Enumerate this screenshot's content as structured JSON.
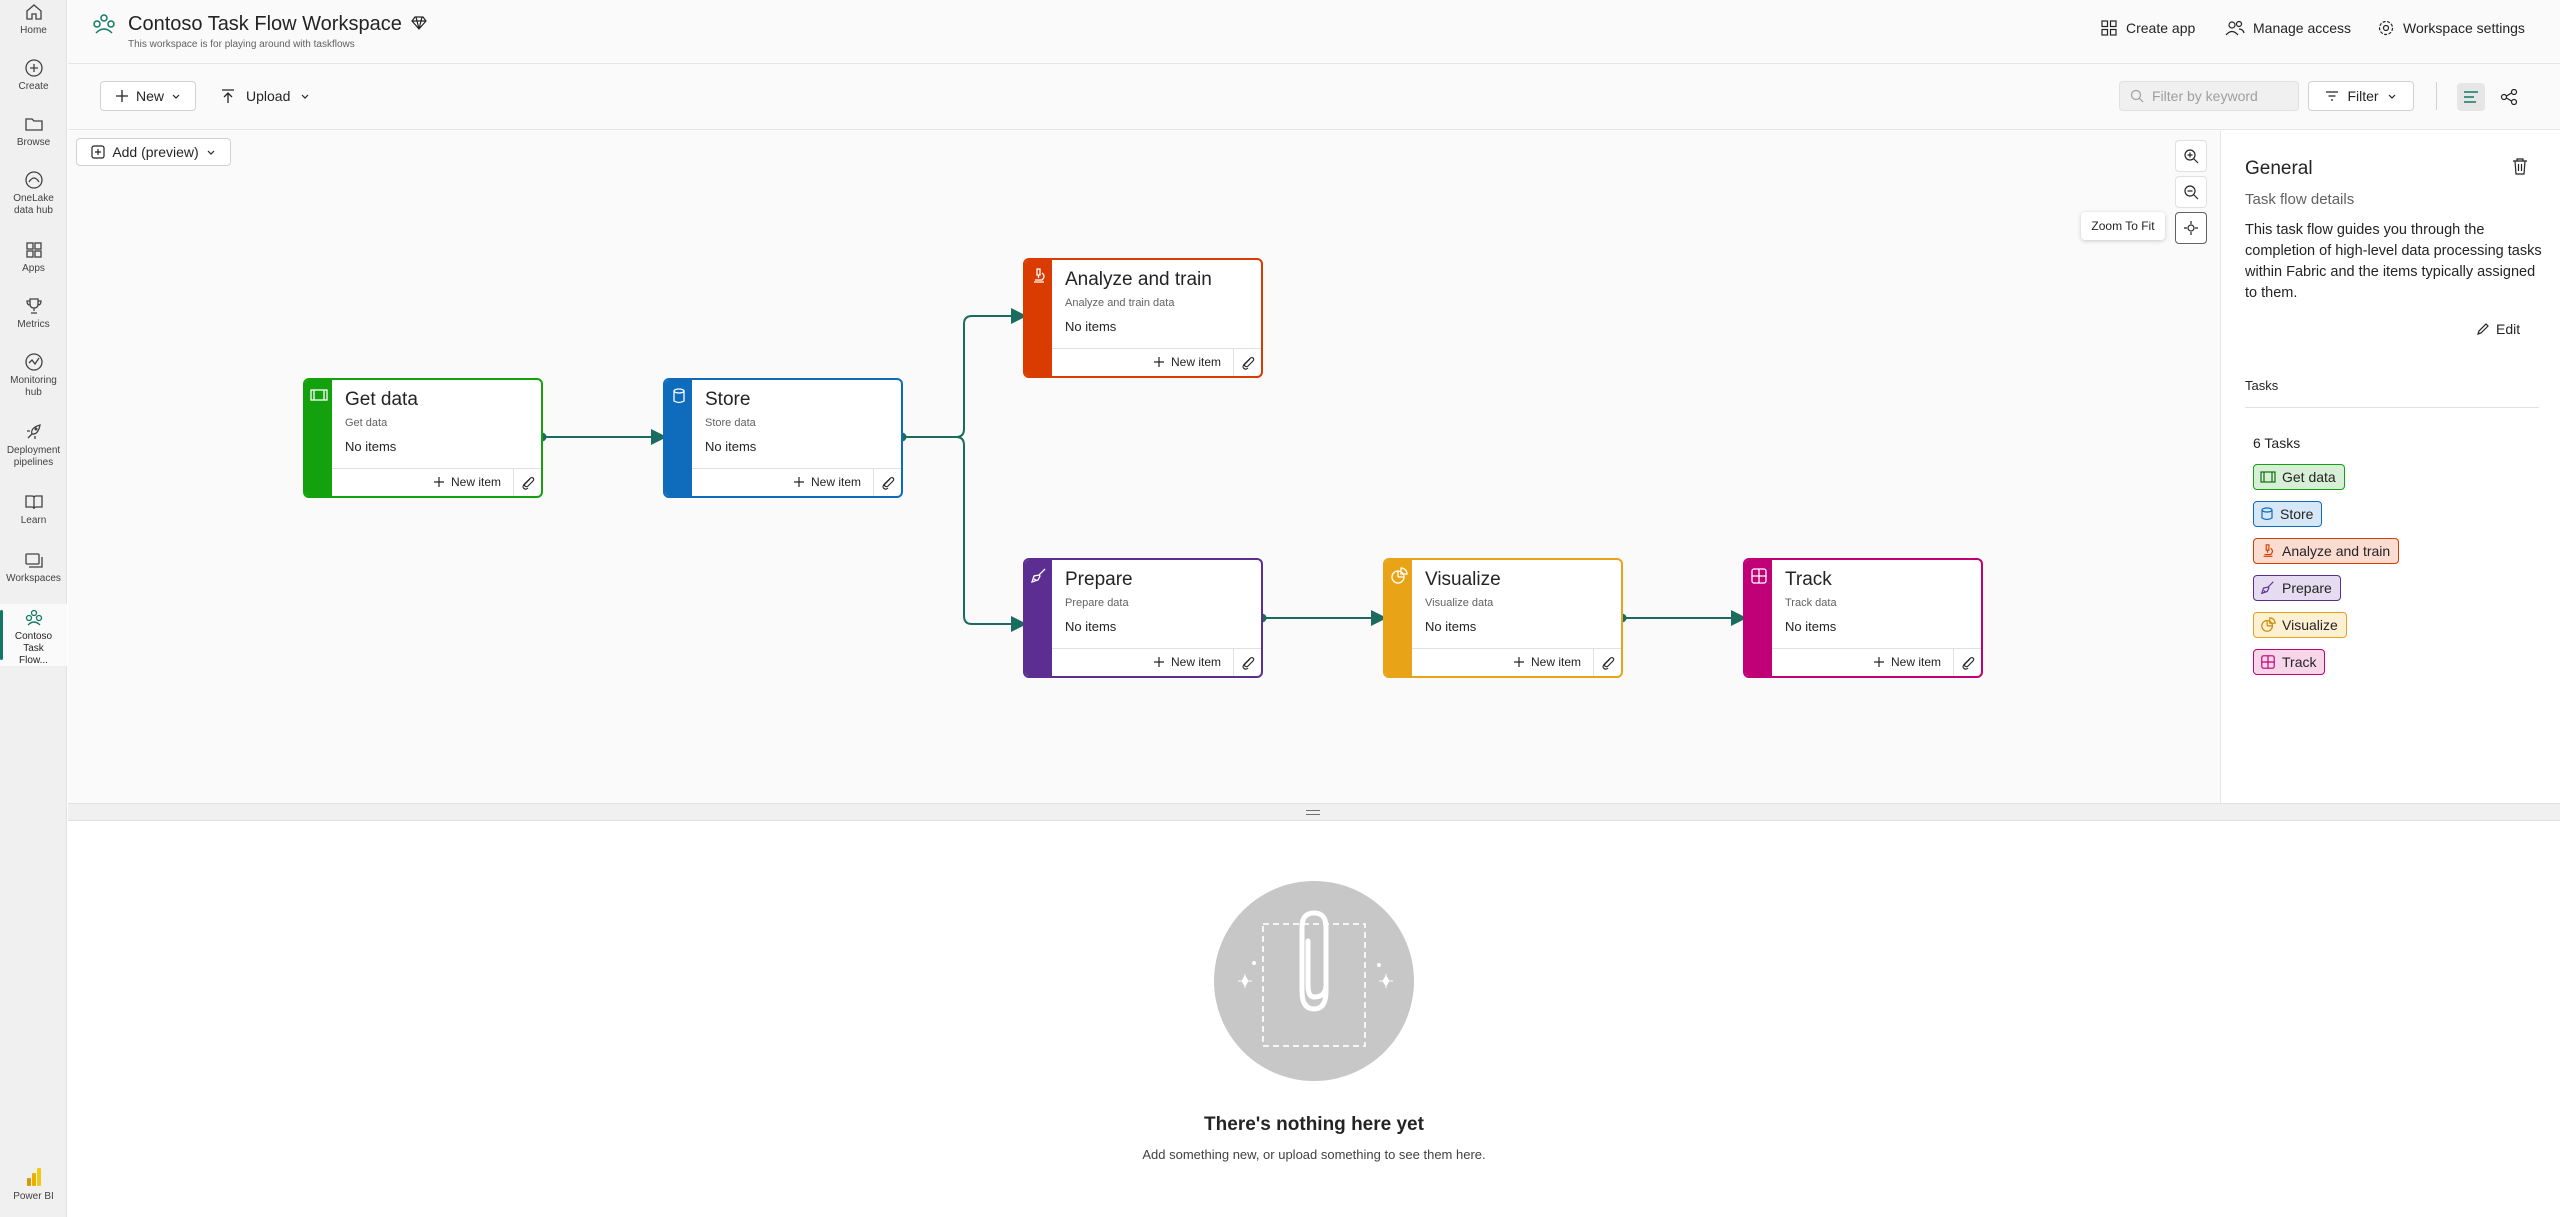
{
  "nav": {
    "items": [
      {
        "label": "Home",
        "icon": "home-icon"
      },
      {
        "label": "Create",
        "icon": "create-icon"
      },
      {
        "label": "Browse",
        "icon": "folder-icon"
      },
      {
        "label": "OneLake data hub",
        "icon": "onelake-icon"
      },
      {
        "label": "Apps",
        "icon": "apps-icon"
      },
      {
        "label": "Metrics",
        "icon": "trophy-icon"
      },
      {
        "label": "Monitoring hub",
        "icon": "monitoring-icon"
      },
      {
        "label": "Deployment pipelines",
        "icon": "rocket-icon"
      },
      {
        "label": "Learn",
        "icon": "book-icon"
      },
      {
        "label": "Workspaces",
        "icon": "workspaces-icon"
      },
      {
        "label": "Contoso Task Flow...",
        "icon": "workspace-icon"
      }
    ],
    "footer": "Power BI"
  },
  "header": {
    "title": "Contoso Task Flow Workspace",
    "subtitle": "This workspace is for playing around with taskflows",
    "actions": {
      "create_app": "Create app",
      "manage_access": "Manage access",
      "workspace_settings": "Workspace settings"
    }
  },
  "toolbar": {
    "new_label": "New",
    "upload_label": "Upload",
    "filter_placeholder": "Filter by keyword",
    "filter_label": "Filter"
  },
  "canvas": {
    "add_label": "Add (preview)",
    "zoom_tooltip": "Zoom To Fit",
    "tasks": [
      {
        "title": "Get data",
        "subtitle": "Get data",
        "status": "No items",
        "new_item": "New item",
        "color": "#13a10e"
      },
      {
        "title": "Store",
        "subtitle": "Store data",
        "status": "No items",
        "new_item": "New item",
        "color": "#0f6cbd"
      },
      {
        "title": "Analyze and train",
        "subtitle": "Analyze and train data",
        "status": "No items",
        "new_item": "New item",
        "color": "#da3b01"
      },
      {
        "title": "Prepare",
        "subtitle": "Prepare data",
        "status": "No items",
        "new_item": "New item",
        "color": "#5c2e91"
      },
      {
        "title": "Visualize",
        "subtitle": "Visualize data",
        "status": "No items",
        "new_item": "New item",
        "color": "#e8a317"
      },
      {
        "title": "Track",
        "subtitle": "Track data",
        "status": "No items",
        "new_item": "New item",
        "color": "#bf0077"
      }
    ],
    "connector_color": "#1b6b5f"
  },
  "panel": {
    "title": "General",
    "subtitle": "Task flow details",
    "description": "This task flow guides you through the completion of high-level data processing tasks within Fabric and the items typically assigned to them.",
    "edit_label": "Edit",
    "tasks_heading": "Tasks",
    "task_count": "6 Tasks",
    "chips": [
      "Get data",
      "Store",
      "Analyze and train",
      "Prepare",
      "Visualize",
      "Track"
    ]
  },
  "empty_state": {
    "title": "There's nothing here yet",
    "subtitle": "Add something new, or upload something to see them here."
  }
}
